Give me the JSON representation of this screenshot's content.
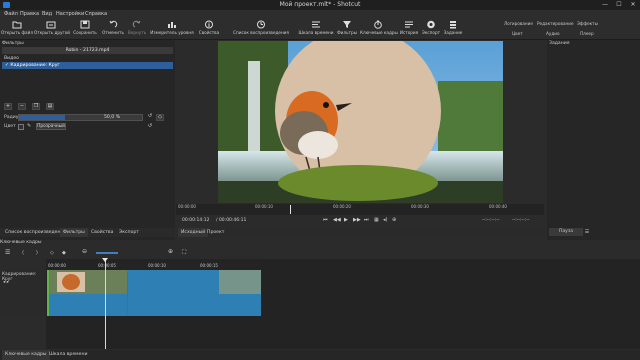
{
  "window": {
    "title": "Мой проект.mlt* - Shotcut",
    "minimize": "—",
    "maximize": "☐",
    "close": "✕"
  },
  "menu": [
    "Файл",
    "Правка",
    "Вид",
    "Настройки",
    "Справка"
  ],
  "toolbar": {
    "buttons": [
      {
        "label": "Открыть файл",
        "icon": "open-folder-icon"
      },
      {
        "label": "Открыть другой",
        "icon": "open-other-icon"
      },
      {
        "label": "Сохранить",
        "icon": "save-icon"
      },
      {
        "label": "Отменить",
        "icon": "undo-icon"
      },
      {
        "label": "Вернуть",
        "icon": "redo-icon"
      },
      {
        "label": "Измеритель уровня",
        "icon": "level-meter-icon"
      },
      {
        "label": "Свойства",
        "icon": "properties-icon"
      },
      {
        "label": "Список воспроизведения",
        "icon": "playlist-icon"
      },
      {
        "label": "Шкала времени",
        "icon": "timeline-icon"
      },
      {
        "label": "Фильтры",
        "icon": "filter-icon"
      },
      {
        "label": "Ключевые кадры",
        "icon": "keyframes-icon"
      },
      {
        "label": "История",
        "icon": "history-icon"
      },
      {
        "label": "Экспорт",
        "icon": "export-icon"
      },
      {
        "label": "Задание",
        "icon": "jobs-icon"
      }
    ],
    "layouts_top": [
      "Логирование",
      "Редактирование",
      "Эффекты"
    ],
    "layouts_bottom": [
      "Цвет",
      "Аудио",
      "Плеер"
    ]
  },
  "filters_panel": {
    "title": "Фильтры",
    "clip_name": "Robin - 21723.mp4",
    "section_label": "Видео",
    "filter_item": "Кадрирование: Круг",
    "add_button": "+",
    "remove_button": "−",
    "radius_label": "Радиус",
    "radius_value": "50,0 %",
    "radius_fraction": 0.5,
    "color_label": "Цвет",
    "color_button": "Прозрачный"
  },
  "left_tabs": [
    "Список воспроизведения",
    "Фильтры",
    "Свойства",
    "Экспорт"
  ],
  "player": {
    "ticks": [
      "00:00:00",
      "00:00:10",
      "00:00:20",
      "00:00:30",
      "00:00:40"
    ],
    "current_time": "00:00:14:12",
    "total_time": "/ 00:00:46:11",
    "source_tab": "Исходный",
    "project_tab": "Проект",
    "in_point": "--:--:--:--",
    "out_point": "--:--:--:--"
  },
  "right_panel": {
    "title": "Задания",
    "pause_button": "Пауза"
  },
  "keyframes": {
    "title": "Ключевые кадры",
    "track_label": "Кадрирование: Круг",
    "ruler": [
      "00:00:00",
      "00:00:05",
      "00:00:10",
      "00:00:15"
    ]
  },
  "bottom_tabs": [
    "Ключевые кадры",
    "Шкала времени"
  ]
}
